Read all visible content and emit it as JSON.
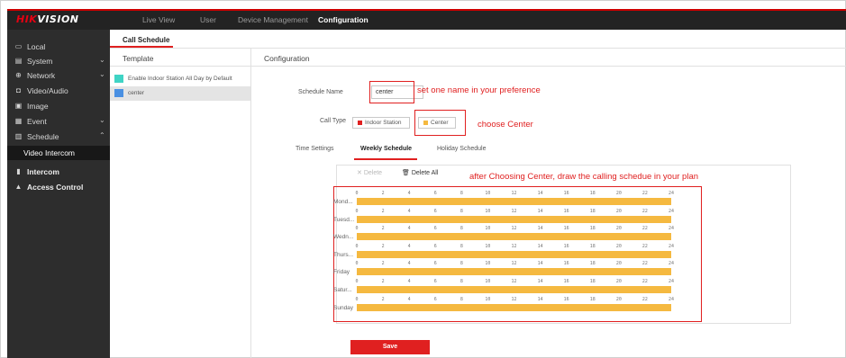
{
  "app": {
    "logo_brand": "HIK",
    "logo_rest": "VISION"
  },
  "topnav": [
    "Live View",
    "User",
    "Device Management",
    "Configuration"
  ],
  "topnav_active": "Configuration",
  "sidebar": {
    "items": [
      {
        "label": "Local",
        "icon": "monitor-icon"
      },
      {
        "label": "System",
        "icon": "system-icon"
      },
      {
        "label": "Network",
        "icon": "network-icon"
      },
      {
        "label": "Video/Audio",
        "icon": "video-icon"
      },
      {
        "label": "Image",
        "icon": "image-icon"
      },
      {
        "label": "Event",
        "icon": "event-icon"
      },
      {
        "label": "Schedule",
        "icon": "calendar-icon"
      },
      {
        "label": "Video Intercom",
        "icon": ""
      },
      {
        "label": "Intercom",
        "icon": "intercom-icon"
      },
      {
        "label": "Access Control",
        "icon": "lock-icon"
      }
    ]
  },
  "tab": {
    "label": "Call Schedule"
  },
  "template_panel": {
    "title": "Template",
    "items": [
      {
        "label": "Enable Indoor Station All Day by Default",
        "color": "#3fd4c5"
      },
      {
        "label": "center",
        "color": "#4a90e2"
      }
    ]
  },
  "config": {
    "title": "Configuration",
    "schedule_name_label": "Schedule Name",
    "schedule_name_value": "center",
    "call_type_label": "Call Type",
    "call_types": [
      {
        "label": "Indoor Station",
        "color": "#e02020"
      },
      {
        "label": "Center",
        "color": "#f5b940"
      }
    ]
  },
  "annotations": {
    "name": "set one name in your preference",
    "center": "choose Center",
    "draw": "after Choosing Center, draw the calling schedue in your plan"
  },
  "subtabs": [
    "Time Settings",
    "Weekly Schedule",
    "Holiday Schedule"
  ],
  "subtab_active": "Weekly Schedule",
  "toolbar": {
    "delete": "Delete",
    "delete_all": "Delete All"
  },
  "schedule": {
    "days": [
      "Mond...",
      "Tuesd...",
      "Wedn...",
      "Thurs...",
      "Friday",
      "Satur...",
      "Sunday"
    ],
    "ticks": [
      "0",
      "2",
      "4",
      "6",
      "8",
      "10",
      "12",
      "14",
      "16",
      "18",
      "20",
      "22",
      "24"
    ],
    "bar_color": "#f5b940"
  },
  "save_label": "Save"
}
